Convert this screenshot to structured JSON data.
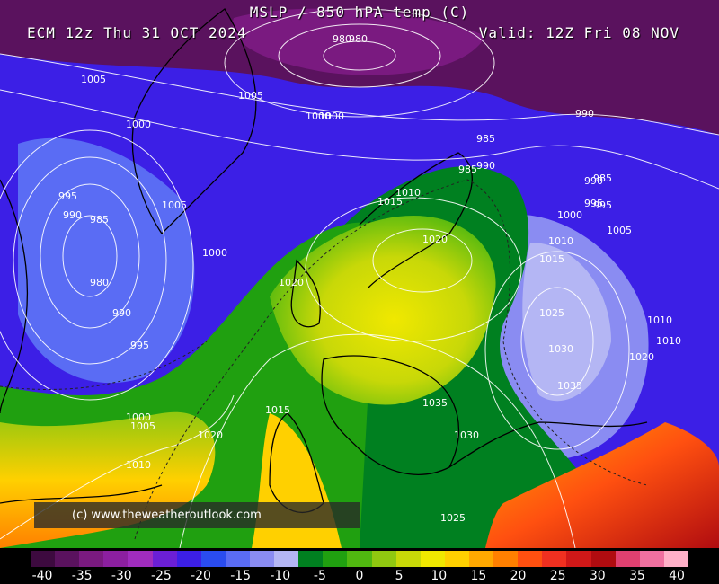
{
  "header": {
    "title": "MSLP / 850 hPA temp (C)",
    "model_run": "ECM 12z Thu 31 OCT 2024",
    "valid_time": "Valid: 12Z Fri 08 NOV"
  },
  "watermark": "(c) www.theweatheroutlook.com",
  "legend": {
    "tick_labels": [
      "-40",
      "-35",
      "-30",
      "-25",
      "-20",
      "-15",
      "-10",
      "-5",
      "0",
      "5",
      "10",
      "15",
      "20",
      "25",
      "30",
      "35",
      "40"
    ],
    "colors": [
      "#3d0a3f",
      "#5a125e",
      "#7a1a80",
      "#8c1fa0",
      "#a02cbe",
      "#6b1fd6",
      "#3c1fe6",
      "#2a4cf0",
      "#5a6cf4",
      "#8a8cf2",
      "#b4b6f4",
      "#008020",
      "#20a010",
      "#50b810",
      "#90c810",
      "#c8d808",
      "#f0e800",
      "#ffd000",
      "#ffa800",
      "#ff8000",
      "#ff5010",
      "#f03020",
      "#d01818",
      "#b00c10",
      "#e04070",
      "#f070a0",
      "#ffb0c8"
    ]
  },
  "isobar_labels": [
    "1005",
    "1000",
    "1005",
    "1000",
    "995",
    "990",
    "985",
    "980",
    "990",
    "995",
    "1000",
    "1005",
    "1000",
    "980",
    "985",
    "990",
    "995",
    "990",
    "985",
    "980",
    "995",
    "1000",
    "1005",
    "1010",
    "1015",
    "1020",
    "1015",
    "1010",
    "1005",
    "1000",
    "1020",
    "1025",
    "1030",
    "1035",
    "1020",
    "1015",
    "1010",
    "1010",
    "1035",
    "1030",
    "1025",
    "1010",
    "1020",
    "990",
    "985"
  ]
}
